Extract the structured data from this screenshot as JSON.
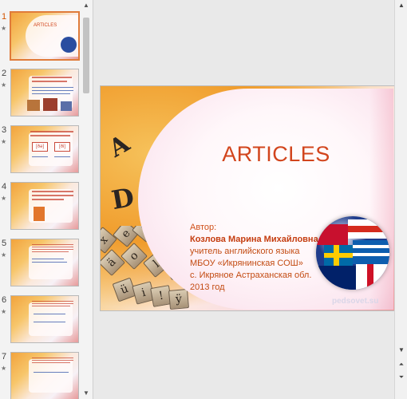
{
  "thumbnails": [
    {
      "number": "1",
      "title": "ARTICLES",
      "selected": true
    },
    {
      "number": "2",
      "title": "THE ВИЧАЕТЬ АРТИКЛ / ОПРЕДЕЛЕННЫЙ АРТИКЛЬ"
    },
    {
      "number": "3",
      "title": "ОПРЕДЕЛЁННЫЙ АРТИКЛЬ ИМЕЕТ ДВА ВАРИАНТА ПРОИЗНОШЕНИЯ",
      "chips": [
        "[ðə]",
        "[ði]"
      ]
    },
    {
      "number": "4",
      "title": "ОПРЕДЕЛЁННЫЙ АРТИКЛЬ ОБЫЧНО УПОТРЕБЛЯЕТСЯ В СЛЕДУЮЩИХ СЛУЧАЯХ:"
    },
    {
      "number": "5",
      "title": "..."
    },
    {
      "number": "6",
      "title": "..."
    },
    {
      "number": "7",
      "title": "..."
    }
  ],
  "slide": {
    "title": "ARTICLES",
    "author_label": "Автор:",
    "author_name": "Козлова Марина Михайловна",
    "author_role": "учитель английского языка",
    "school": "МБОУ «Икрянинская СОШ»",
    "location": "с. Икряное Астраханская обл.",
    "year": "2013 год",
    "watermark": "pedsovet.su",
    "letters": [
      "A",
      "D"
    ],
    "keys": [
      "x",
      "e",
      "t",
      "ä",
      "o",
      "N",
      "l",
      "o",
      "g",
      "ü",
      "i",
      "!",
      "ÿ"
    ]
  },
  "colors": {
    "accent": "#d2451d",
    "selection": "#e07b3a"
  }
}
